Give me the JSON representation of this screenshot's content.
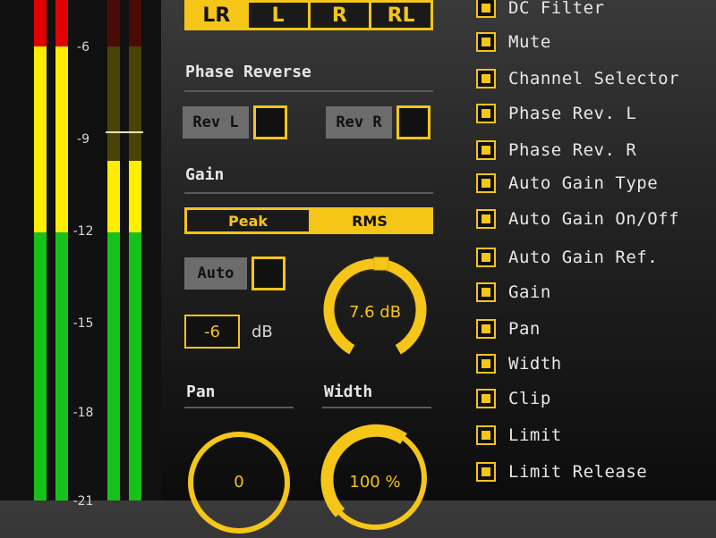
{
  "meter": {
    "ticks": [
      "-6",
      "-9",
      "-12",
      "-15",
      "-18",
      "-21"
    ],
    "colors": {
      "red": "#e00000",
      "yellow": "#ffee00",
      "green": "#16c21a",
      "dark_red": "#4a0b06",
      "dark_yellow": "#4a4306"
    }
  },
  "channel": {
    "buttons": [
      "LR",
      "L",
      "R",
      "RL"
    ],
    "selected": "LR"
  },
  "phase": {
    "title": "Phase Reverse",
    "rev_l_label": "Rev L",
    "rev_r_label": "Rev R"
  },
  "gain": {
    "title": "Gain",
    "mode_peak": "Peak",
    "mode_rms": "RMS",
    "mode_selected": "RMS",
    "auto_label": "Auto",
    "target_value": "-6",
    "target_unit": "dB",
    "knob_value": "7.6 dB"
  },
  "pan": {
    "title": "Pan",
    "knob_value": "0"
  },
  "width": {
    "title": "Width",
    "knob_value": "100 %"
  },
  "list": {
    "items": [
      "DC Filter",
      "Mute",
      "Channel Selector",
      "Phase Rev. L",
      "Phase Rev. R",
      "Auto Gain Type",
      "Auto Gain On/Off",
      "Auto Gain Ref.",
      "Gain",
      "Pan",
      "Width",
      "Clip",
      "Limit",
      "Limit Release"
    ]
  },
  "accent_color": "#f5c518"
}
